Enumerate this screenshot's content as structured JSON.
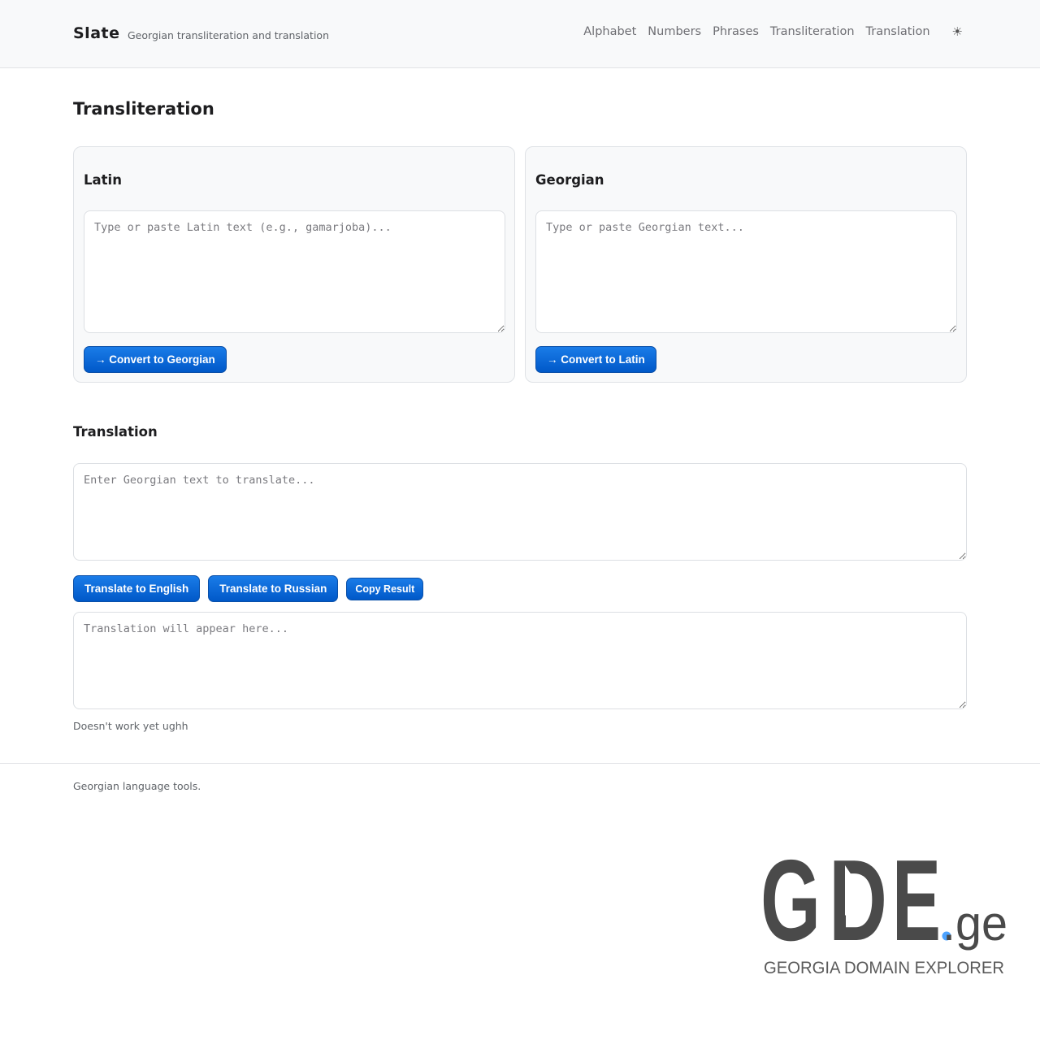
{
  "header": {
    "brand": "Slate",
    "tagline": "Georgian transliteration and translation",
    "nav": [
      "Alphabet",
      "Numbers",
      "Phrases",
      "Transliteration",
      "Translation"
    ],
    "theme_toggle_icon": "sun-icon",
    "theme_toggle_glyph": "☀"
  },
  "transliteration": {
    "title": "Transliteration",
    "latin": {
      "heading": "Latin",
      "value": "",
      "placeholder": "Type or paste Latin text (e.g., gamarjoba)...",
      "button": "→ Convert to Georgian"
    },
    "georgian": {
      "heading": "Georgian",
      "value": "",
      "placeholder": "Type or paste Georgian text...",
      "button": "→ Convert to Latin"
    }
  },
  "translation": {
    "title": "Translation",
    "input_value": "",
    "input_placeholder": "Enter Georgian text to translate...",
    "buttons": {
      "english": "Translate to English",
      "russian": "Translate to Russian",
      "copy": "Copy Result"
    },
    "output_value": "",
    "output_placeholder": "Translation will appear here...",
    "note": "Doesn't work yet ughh"
  },
  "footer": {
    "text": "Georgian language tools.",
    "logo": {
      "letter_g": "G",
      "letter_d": "D",
      "letter_e": "E",
      "tld": ".ge",
      "subtitle": "GEORGIA DOMAIN EXPLORER",
      "color_primary": "#4a4a4a",
      "color_dot": "#4da3ff"
    }
  },
  "colors": {
    "accent": "#0a66d8",
    "header_bg": "#f8f9fa",
    "panel_bg": "#f8f9fa",
    "border": "#dfe2e6"
  }
}
